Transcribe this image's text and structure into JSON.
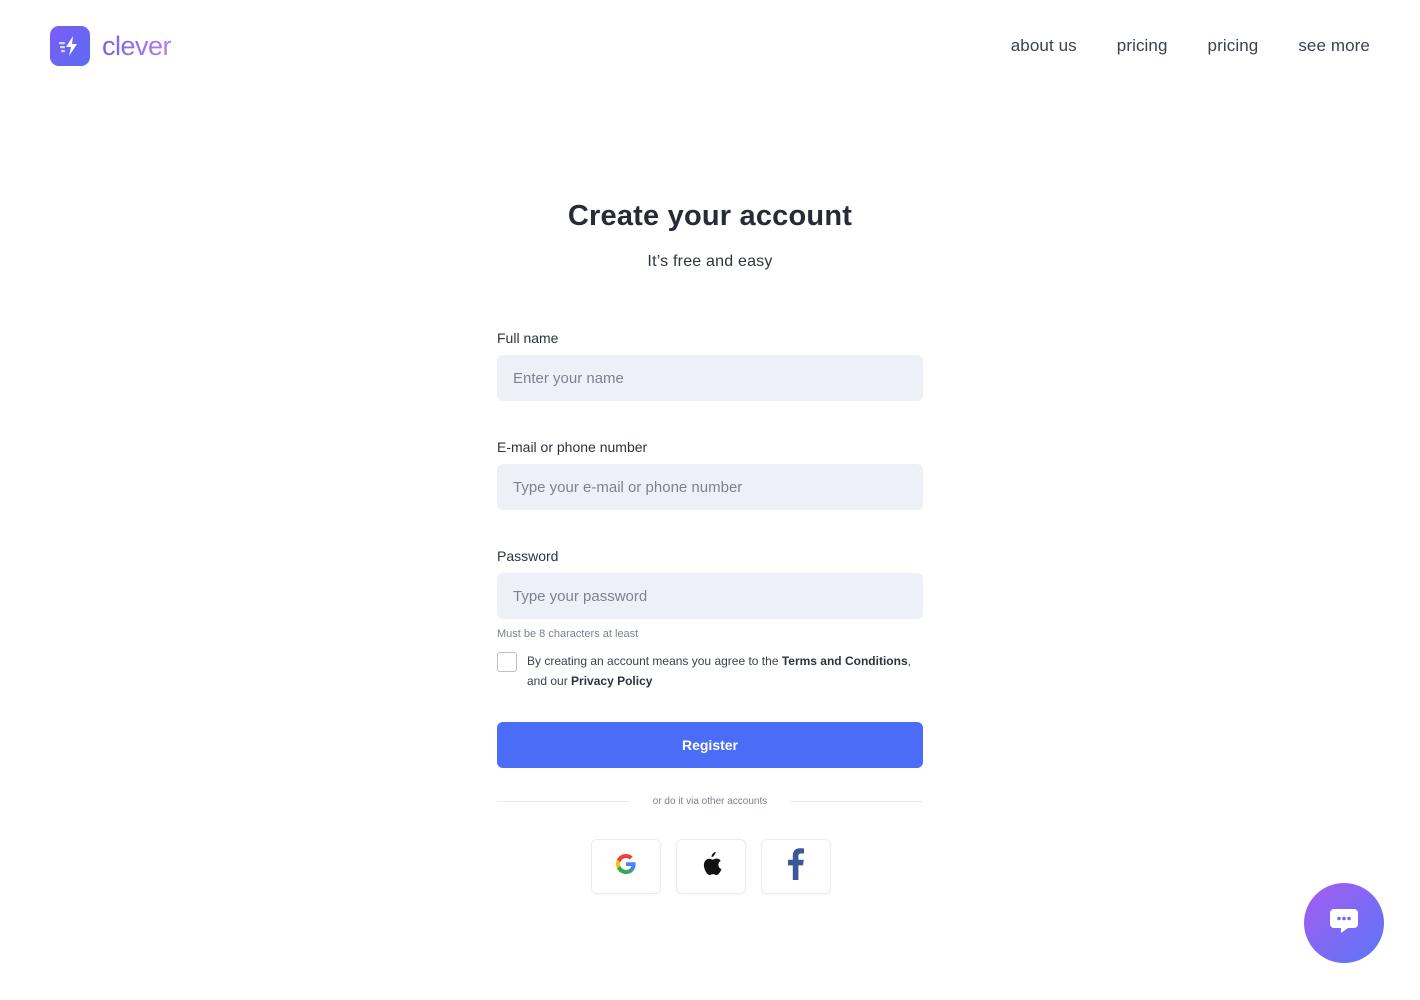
{
  "brand": {
    "name": "clever",
    "accent": "#6e62f2"
  },
  "nav": {
    "items": [
      "about us",
      "pricing",
      "pricing",
      "see more"
    ]
  },
  "heading": {
    "title": "Create your account",
    "subtitle": "It’s free and easy"
  },
  "form": {
    "full_name": {
      "label": "Full name",
      "placeholder": "Enter your name",
      "value": ""
    },
    "contact": {
      "label": "E-mail or phone number",
      "placeholder": "Type your e-mail or phone number",
      "value": ""
    },
    "password": {
      "label": "Password",
      "placeholder": "Type your password",
      "value": "",
      "hint": "Must be 8 characters at least"
    },
    "agree": {
      "checked": false,
      "prefix": "By creating an account means you agree to the ",
      "terms": "Terms and Conditions",
      "middle": ", and our ",
      "privacy": "Privacy Policy"
    },
    "register_label": "Register",
    "divider_text": "or do it via other accounts"
  },
  "social": {
    "icons": [
      "google-icon",
      "apple-icon",
      "facebook-icon"
    ]
  },
  "chat": {
    "icon": "chat-icon",
    "colors": [
      "#a55cf2",
      "#5b76f6"
    ]
  },
  "colors": {
    "primary": "#4a6cf7",
    "input_bg": "#edf1f7"
  }
}
